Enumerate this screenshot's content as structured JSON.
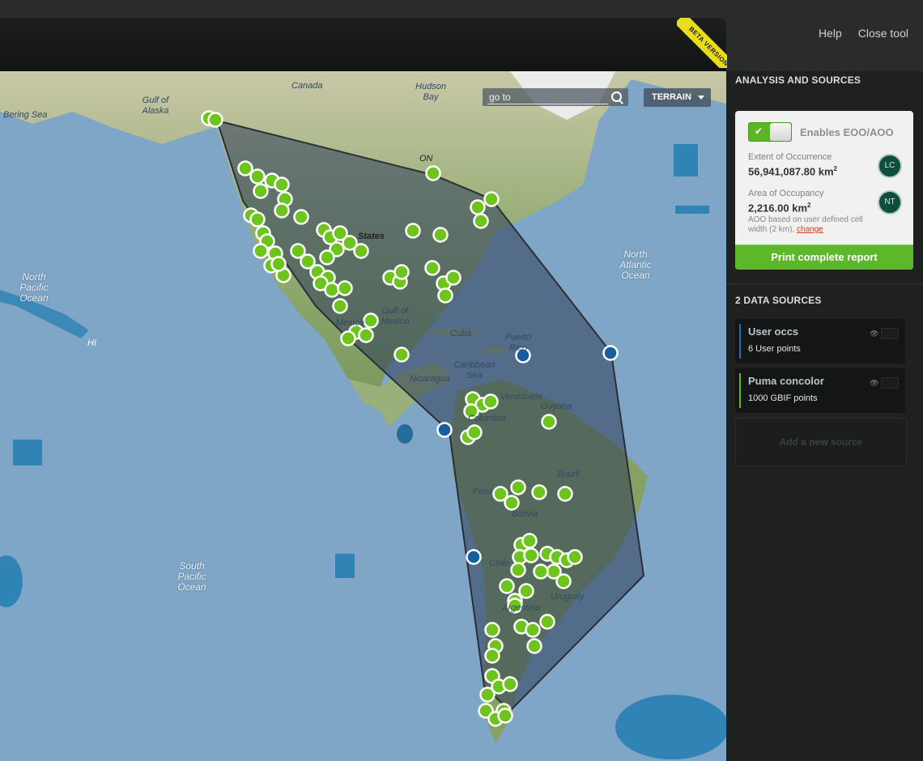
{
  "topbar": {
    "help": "Help",
    "close": "Close tool",
    "ribbon": "BETA VERSION"
  },
  "map": {
    "search_placeholder": "go to",
    "layer_select": "TERRAIN",
    "labels": {
      "bering": "Bering Sea",
      "alaska": "Gulf of Alaska",
      "canada": "Canada",
      "hudson": "Hudson Bay",
      "npacific": "North Pacific Ocean",
      "natlantic": "North Atlantic Ocean",
      "spacific": "South Pacific Ocean",
      "mexico": "Mexico",
      "gulfmexico": "Gulf of Mexico",
      "caribbean": "Caribbean Sea",
      "cuba": "Cuba",
      "puerto": "Puerto Rico",
      "nicaragua": "Nicaragua",
      "venezuela": "Venezuela",
      "guyana": "Guyana",
      "colombia": "Colombia",
      "brazil": "Brazil",
      "peru": "Peru",
      "bolivia": "Bolivia",
      "chile": "Chile",
      "argentina": "Argentina",
      "uruguay": "Uruguay",
      "states": "States",
      "hi": "HI",
      "on": "ON"
    }
  },
  "sidebar": {
    "analysis_title": "ANALYSIS AND SOURCES",
    "eoo_toggle_label": "Enables EOO/AOO",
    "eoo_label": "Extent of Occurrence",
    "eoo_value": "56,941,087.80 km",
    "eoo_badge": "LC",
    "aoo_label": "Area of Occupancy",
    "aoo_value": "2,216.00 km",
    "aoo_badge": "NT",
    "aoo_note": "AOO based on user defined cell width (2 km),",
    "aoo_change": "change",
    "print_button": "Print complete report",
    "sources_title": "2 DATA SOURCES",
    "sources": [
      {
        "name": "User occs",
        "points": "6 User points",
        "color": "#1f6fb3"
      },
      {
        "name": "Puma concolor",
        "points": "1000 GBIF points",
        "color": "#5cb82a"
      }
    ],
    "add_source": "Add a new source"
  },
  "colors": {
    "accent": "#5cb82a",
    "user_points": "#155f9f",
    "gbif_points": "#6dc41c"
  }
}
